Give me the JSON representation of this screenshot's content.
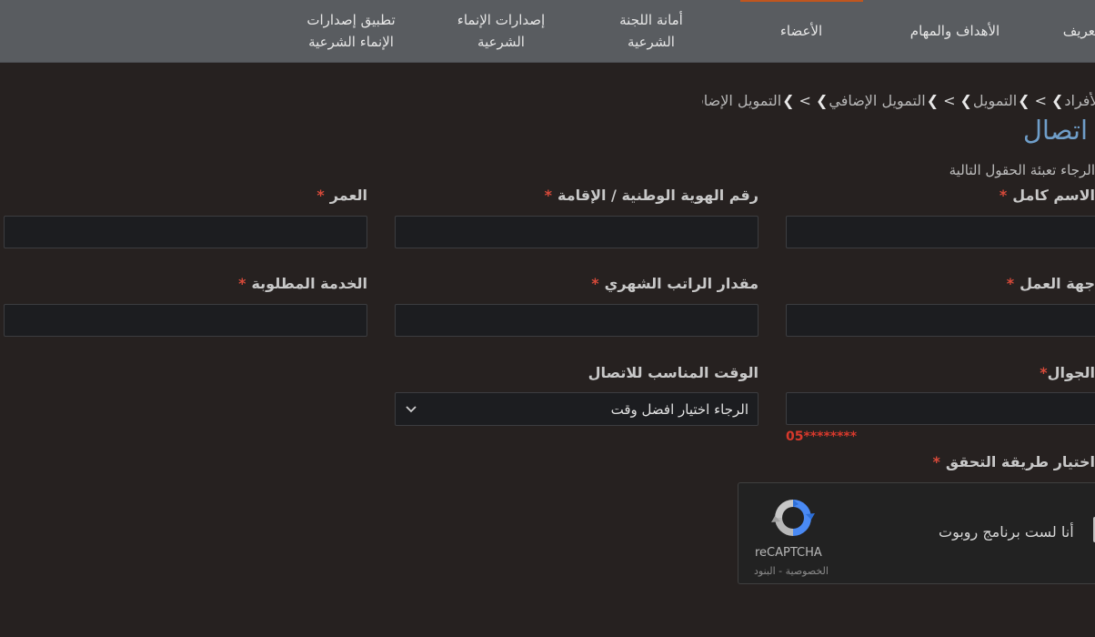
{
  "nav": {
    "items": [
      {
        "label": "التعريف"
      },
      {
        "label": "الأهداف والمهام"
      },
      {
        "label": "الأعضاء"
      },
      {
        "label": "أمانة اللجنة الشرعية"
      },
      {
        "label": "إصدارات الإنماء الشرعية"
      },
      {
        "label": "تطبيق إصدارات الإنماء الشرعية"
      }
    ],
    "accent_color": "#c0561f"
  },
  "breadcrumb": {
    "items": [
      "الأفراد",
      "التمويل",
      "التمويل الإضافي",
      "التمويل الإضافي"
    ],
    "separator": ">"
  },
  "page": {
    "title": "اتصال",
    "instructions": "الرجاء تعبئة الحقول التالية"
  },
  "form": {
    "required_mark": "*",
    "full_name": {
      "label": "الاسم كامل",
      "value": ""
    },
    "national_id": {
      "label": "رقم الهوية الوطنية / الإقامة",
      "value": ""
    },
    "age": {
      "label": "العمر",
      "value": ""
    },
    "employer": {
      "label": "جهة العمل",
      "value": ""
    },
    "salary": {
      "label": "مقدار الراتب الشهري",
      "value": ""
    },
    "service": {
      "label": "الخدمة المطلوبة",
      "value": ""
    },
    "mobile": {
      "label": "الجوال",
      "value": "",
      "hint": "05********"
    },
    "contact_time": {
      "label": "الوقت المناسب للاتصال",
      "selected": "الرجاء اختيار افضل وقت"
    },
    "verification": {
      "label": "اختيار طريقة التحقق"
    }
  },
  "recaptcha": {
    "label": "أنا لست برنامج روبوت",
    "brand": "reCAPTCHA",
    "privacy": "الخصوصية",
    "link_separator": " - ",
    "terms": "البنود"
  },
  "colors": {
    "background": "#262120",
    "nav_background": "#595c60",
    "title": "#6f9ec9",
    "required": "#d84a3a"
  }
}
